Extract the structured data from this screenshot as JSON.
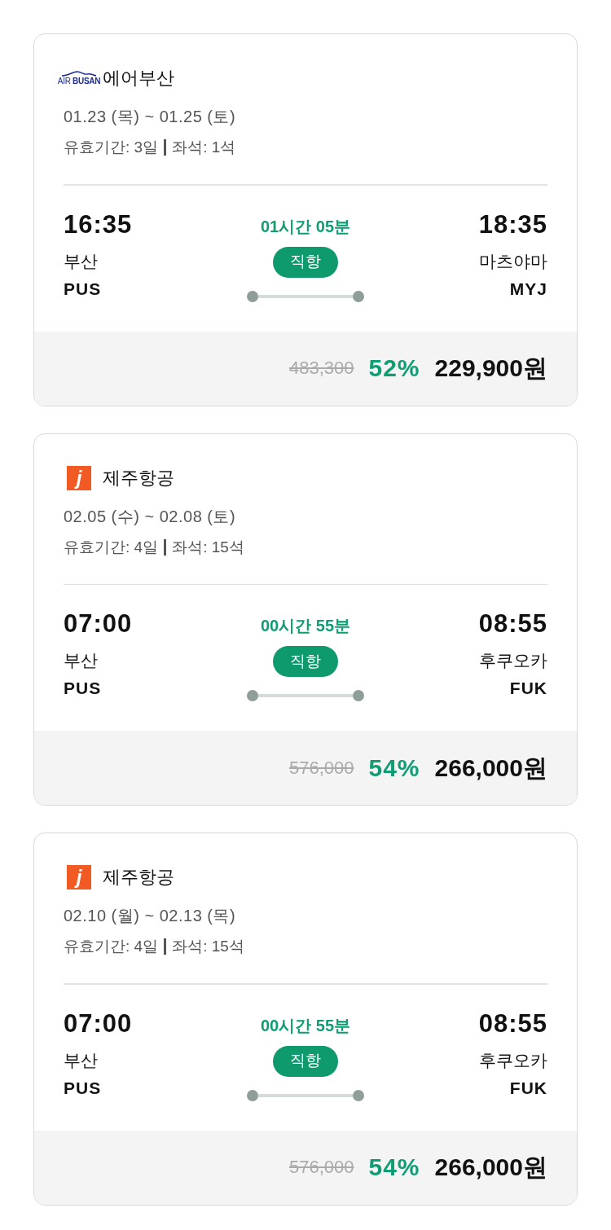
{
  "flights": [
    {
      "airline": {
        "kind": "airbusan",
        "logo_text": "AIR **BUSAN**",
        "name": "에어부산"
      },
      "dates": "01.23 (목) ~ 01.25 (토)",
      "validity": "유효기간: 3일",
      "seats": "좌석: 1석",
      "departure": {
        "time": "16:35",
        "city": "부산",
        "code": "PUS"
      },
      "duration": "01시간 05분",
      "route_type": "직항",
      "arrival": {
        "time": "18:35",
        "city": "마츠야마",
        "code": "MYJ"
      },
      "original_price": "483,300",
      "discount": "52%",
      "price": "229,900원"
    },
    {
      "airline": {
        "kind": "jeju",
        "logo_text": "j",
        "name": "제주항공"
      },
      "dates": "02.05 (수) ~ 02.08 (토)",
      "validity": "유효기간: 4일",
      "seats": "좌석: 15석",
      "departure": {
        "time": "07:00",
        "city": "부산",
        "code": "PUS"
      },
      "duration": "00시간 55분",
      "route_type": "직항",
      "arrival": {
        "time": "08:55",
        "city": "후쿠오카",
        "code": "FUK"
      },
      "original_price": "576,000",
      "discount": "54%",
      "price": "266,000원"
    },
    {
      "airline": {
        "kind": "jeju",
        "logo_text": "j",
        "name": "제주항공"
      },
      "dates": "02.10 (월) ~ 02.13 (목)",
      "validity": "유효기간: 4일",
      "seats": "좌석: 15석",
      "departure": {
        "time": "07:00",
        "city": "부산",
        "code": "PUS"
      },
      "duration": "00시간 55분",
      "route_type": "직항",
      "arrival": {
        "time": "08:55",
        "city": "후쿠오카",
        "code": "FUK"
      },
      "original_price": "576,000",
      "discount": "54%",
      "price": "266,000원"
    }
  ]
}
